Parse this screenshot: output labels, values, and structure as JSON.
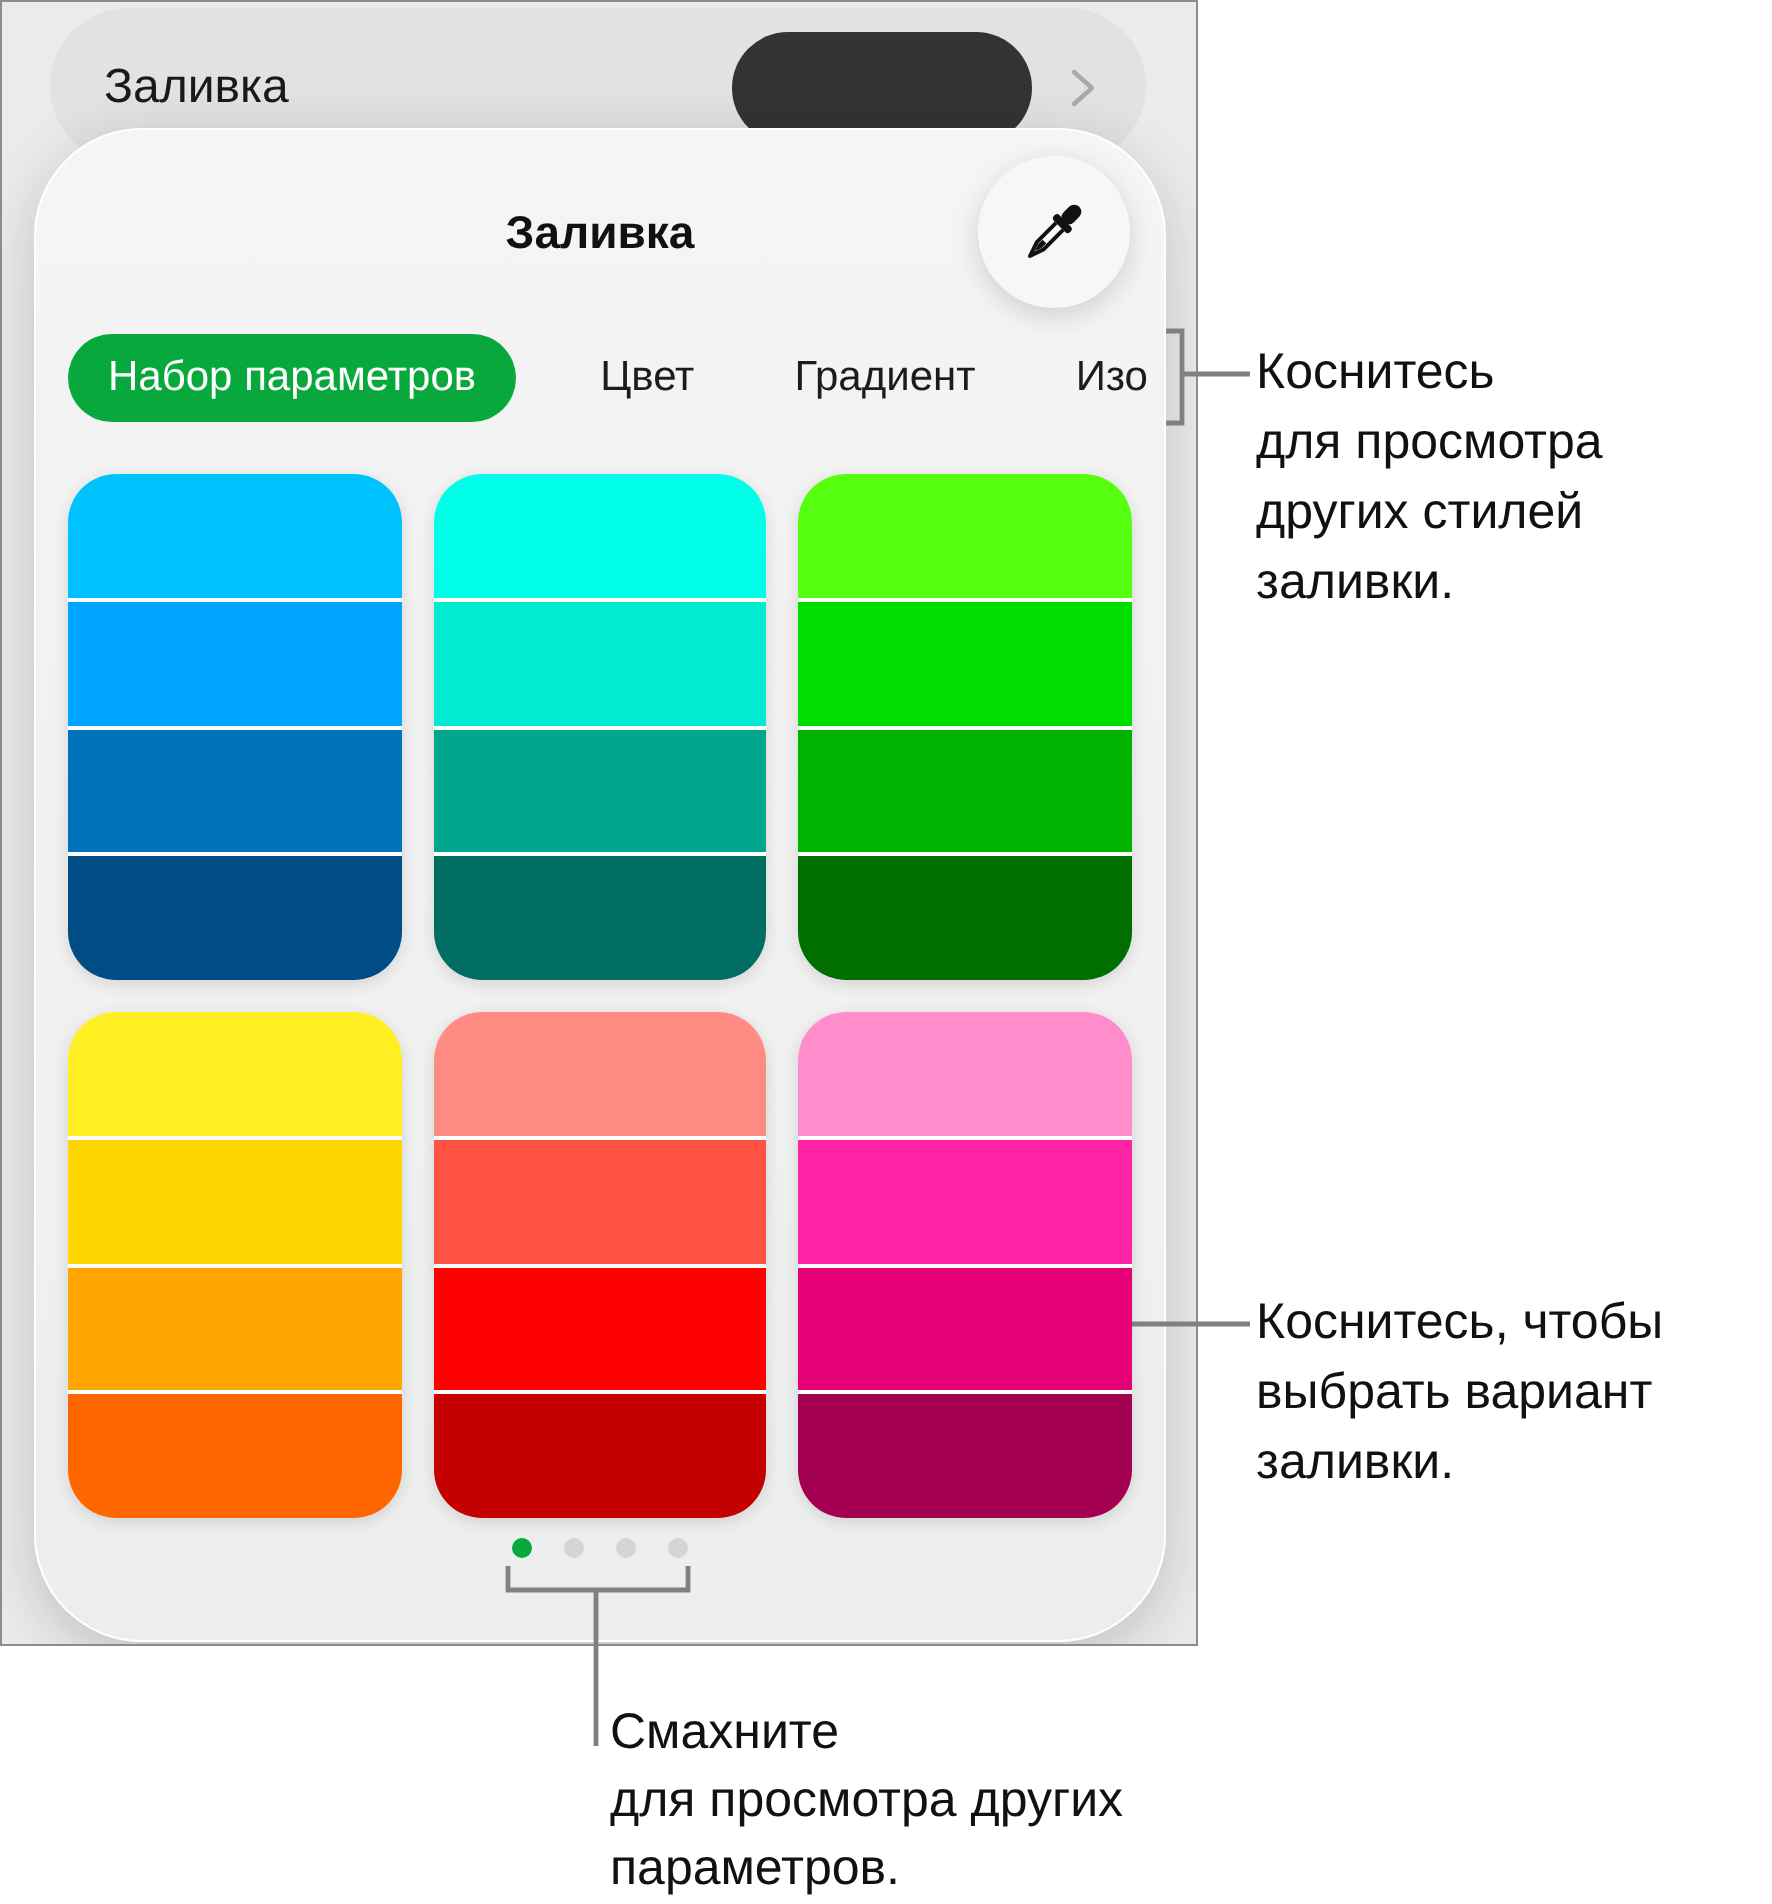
{
  "fill_row": {
    "label": "Заливка"
  },
  "popover": {
    "title": "Заливка",
    "tabs": [
      {
        "label": "Набор параметров",
        "selected": true
      },
      {
        "label": "Цвет",
        "selected": false
      },
      {
        "label": "Градиент",
        "selected": false
      },
      {
        "label": "Изо",
        "selected": false
      }
    ],
    "presets": [
      {
        "bands": [
          {
            "color": "#00c2ff"
          },
          {
            "color": "#00a5ff"
          },
          {
            "color": "#0073bb"
          },
          {
            "color": "#004d85"
          }
        ]
      },
      {
        "bands": [
          {
            "color": "#00ffe8"
          },
          {
            "color": "#00ebd2"
          },
          {
            "color": "#00a78c"
          },
          {
            "color": "#006e63"
          }
        ]
      },
      {
        "bands": [
          {
            "color": "#56ff10"
          },
          {
            "color": "#00de00"
          },
          {
            "color": "#00b300"
          },
          {
            "color": "#006f00"
          }
        ]
      },
      {
        "bands": [
          {
            "color": "#ffee22"
          },
          {
            "color": "#ffd500"
          },
          {
            "color": "#ffa500"
          },
          {
            "color": "#ff6600"
          }
        ]
      },
      {
        "bands": [
          {
            "color": "#ff8c82"
          },
          {
            "color": "#ff5242"
          },
          {
            "color": "#ff0000"
          },
          {
            "color": "#c40000"
          }
        ]
      },
      {
        "bands": [
          {
            "color": "#ff8ccb"
          },
          {
            "color": "#ff22a6"
          },
          {
            "color": "#e50075"
          },
          {
            "color": "#a30052"
          }
        ]
      }
    ],
    "pages": [
      {
        "selected": true
      },
      {
        "selected": false
      },
      {
        "selected": false
      },
      {
        "selected": false
      }
    ]
  },
  "callouts": [
    {
      "text": "Коснитесь\nдля просмотра\nдругих стилей\nзаливки."
    },
    {
      "text": "Коснитесь, чтобы\nвыбрать вариант\nзаливки."
    },
    {
      "text": "Смахните\nдля просмотра других\nпараметров."
    }
  ]
}
